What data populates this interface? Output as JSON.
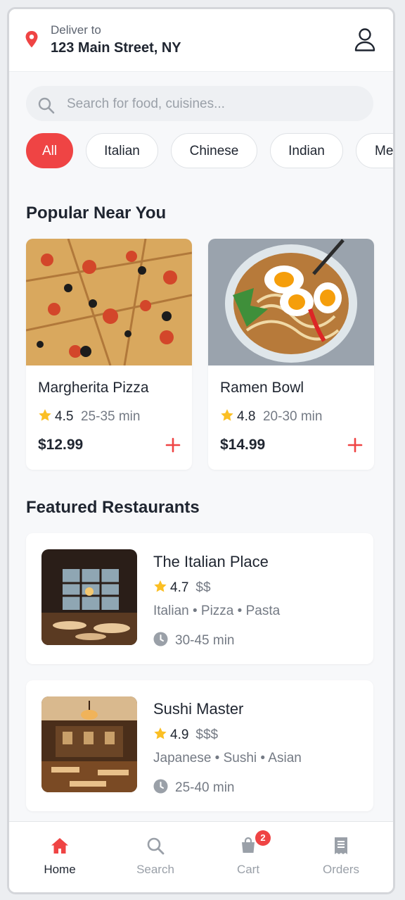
{
  "header": {
    "deliver_label": "Deliver to",
    "address": "123 Main Street, NY"
  },
  "search": {
    "placeholder": "Search for food, cuisines..."
  },
  "categories": [
    "All",
    "Italian",
    "Chinese",
    "Indian",
    "Me"
  ],
  "popular": {
    "title": "Popular Near You",
    "items": [
      {
        "name": "Margherita Pizza",
        "rating": "4.5",
        "time": "25-35 min",
        "price": "$12.99"
      },
      {
        "name": "Ramen Bowl",
        "rating": "4.8",
        "time": "20-30 min",
        "price": "$14.99"
      }
    ]
  },
  "featured": {
    "title": "Featured Restaurants",
    "items": [
      {
        "name": "The Italian Place",
        "rating": "4.7",
        "price_level": "$$",
        "cuisines": "Italian • Pizza • Pasta",
        "time": "30-45 min"
      },
      {
        "name": "Sushi Master",
        "rating": "4.9",
        "price_level": "$$$",
        "cuisines": "Japanese • Sushi • Asian",
        "time": "25-40 min"
      }
    ]
  },
  "tabbar": {
    "tabs": [
      {
        "label": "Home",
        "icon": "home-icon"
      },
      {
        "label": "Search",
        "icon": "search-icon"
      },
      {
        "label": "Cart",
        "icon": "cart-icon"
      },
      {
        "label": "Orders",
        "icon": "orders-icon"
      }
    ],
    "cart_badge": "2"
  },
  "colors": {
    "accent": "#ef4444",
    "star": "#fbbf24",
    "text": "#1f2530",
    "muted": "#747a84"
  }
}
